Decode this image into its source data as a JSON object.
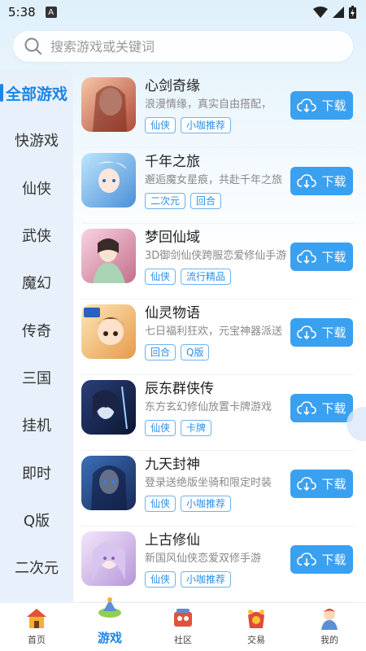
{
  "status": {
    "time": "5:38",
    "badge": "A"
  },
  "search": {
    "placeholder": "搜索游戏或关键词"
  },
  "sidebar": {
    "items": [
      {
        "label": "全部游戏"
      },
      {
        "label": "快游戏"
      },
      {
        "label": "仙侠"
      },
      {
        "label": "武侠"
      },
      {
        "label": "魔幻"
      },
      {
        "label": "传奇"
      },
      {
        "label": "三国"
      },
      {
        "label": "挂机"
      },
      {
        "label": "即时"
      },
      {
        "label": "Q版"
      },
      {
        "label": "二次元"
      }
    ]
  },
  "download_label": "下载",
  "games": [
    {
      "title": "心剑奇缘",
      "desc": "浪漫情缘，真实自由搭配，",
      "tags": [
        "仙侠",
        "小咖推荐"
      ]
    },
    {
      "title": "千年之旅",
      "desc": "邂逅魔女星痕，共赴千年之旅",
      "tags": [
        "二次元",
        "回合"
      ]
    },
    {
      "title": "梦回仙域",
      "desc": "3D御剑仙侠跨服恋爱修仙手游",
      "tags": [
        "仙侠",
        "流行精品"
      ]
    },
    {
      "title": "仙灵物语",
      "desc": "七日福利狂欢，元宝神器派送",
      "tags": [
        "回合",
        "Q版"
      ]
    },
    {
      "title": "辰东群侠传",
      "desc": "东方玄幻修仙放置卡牌游戏",
      "tags": [
        "仙侠",
        "卡牌"
      ]
    },
    {
      "title": "九天封神",
      "desc": "登录送绝版坐骑和限定时装",
      "tags": [
        "仙侠",
        "小咖推荐"
      ]
    },
    {
      "title": "上古修仙",
      "desc": "新国风仙侠恋爱双修手游",
      "tags": [
        "仙侠",
        "小咖推荐"
      ]
    }
  ],
  "bottom_nav": [
    {
      "label": "首页"
    },
    {
      "label": "游戏"
    },
    {
      "label": "社区"
    },
    {
      "label": "交易"
    },
    {
      "label": "我的"
    }
  ],
  "colors": {
    "accent": "#1a86e6",
    "button": "#3aa0f0",
    "sidebar_bg": "#e8f1fb"
  }
}
